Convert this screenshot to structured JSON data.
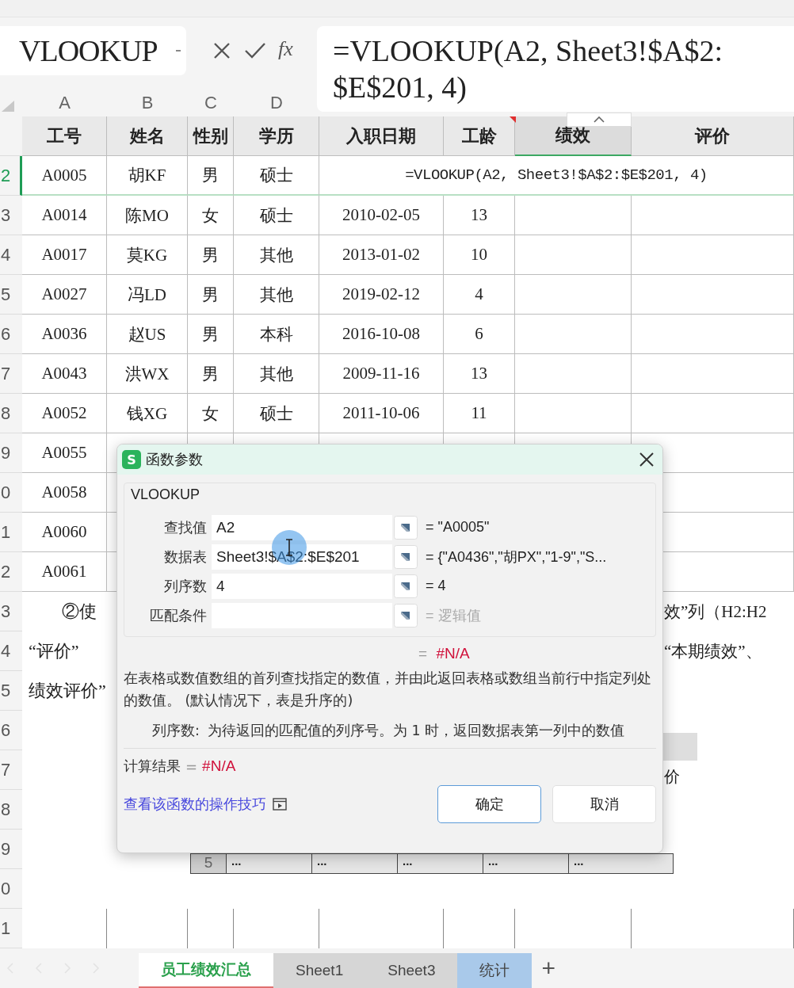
{
  "formula_bar": {
    "name_box": "VLOOKUP",
    "fx_label": "fx",
    "lines": [
      "=VLOOKUP(A2, Sheet3!$A$2:",
      "$E$201, 4)"
    ]
  },
  "column_letters": [
    "A",
    "B",
    "C",
    "D"
  ],
  "headers": [
    {
      "text": "工号",
      "selected": false
    },
    {
      "text": "姓名",
      "selected": false
    },
    {
      "text": "性别",
      "selected": false
    },
    {
      "text": "学历",
      "selected": false
    },
    {
      "text": "入职日期",
      "selected": false
    },
    {
      "text": "工龄",
      "selected": false
    },
    {
      "text": "绩效",
      "selected": true
    },
    {
      "text": "评价",
      "selected": false
    }
  ],
  "rows": [
    {
      "row": "2",
      "selected": true,
      "cells": [
        "A0005",
        "胡KF",
        "男",
        "硕士"
      ],
      "spill": "=VLOOKUP(A2, Sheet3!$A$2:$E$201, 4)"
    },
    {
      "row": "3",
      "selected": false,
      "cells": [
        "A0014",
        "陈MO",
        "女",
        "硕士",
        "2010-02-05",
        "13"
      ]
    },
    {
      "row": "4",
      "selected": false,
      "cells": [
        "A0017",
        "莫KG",
        "男",
        "其他",
        "2013-01-02",
        "10"
      ]
    },
    {
      "row": "5",
      "selected": false,
      "cells": [
        "A0027",
        "冯LD",
        "男",
        "其他",
        "2019-02-12",
        "4"
      ]
    },
    {
      "row": "6",
      "selected": false,
      "cells": [
        "A0036",
        "赵US",
        "男",
        "本科",
        "2016-10-08",
        "6"
      ]
    },
    {
      "row": "7",
      "selected": false,
      "cells": [
        "A0043",
        "洪WX",
        "男",
        "其他",
        "2009-11-16",
        "13"
      ]
    },
    {
      "row": "8",
      "selected": false,
      "cells": [
        "A0052",
        "钱XG",
        "女",
        "硕士",
        "2011-10-06",
        "11"
      ]
    },
    {
      "row": "9",
      "selected": false,
      "cells": [
        "A0055"
      ]
    },
    {
      "row": "0",
      "selected": false,
      "cells": [
        "A0058"
      ]
    },
    {
      "row": "1",
      "selected": false,
      "cells": [
        "A0060"
      ]
    },
    {
      "row": "2",
      "selected": false,
      "cells": [
        "A0061"
      ]
    }
  ],
  "notes": [
    {
      "row": "3",
      "left": "②使",
      "right": "效”列（H2:H2"
    },
    {
      "row": "4",
      "left": "“评价”",
      "right": "“本期绩效”、"
    },
    {
      "row": "5",
      "left": "绩效评价”"
    }
  ],
  "blank_rows": [
    "6",
    "7",
    "8",
    "9",
    "0",
    "1"
  ],
  "embedded_table": {
    "header_text": "价",
    "last_row": {
      "number": "5",
      "cells": [
        "...",
        "...",
        "...",
        "...",
        "..."
      ]
    }
  },
  "dialog": {
    "badge": "S",
    "title": "函数参数",
    "function": "VLOOKUP",
    "params": [
      {
        "label": "查找值",
        "value": "A2",
        "result": "= \"A0005\"",
        "muted": false
      },
      {
        "label": "数据表",
        "value": "Sheet3!$A$2:$E$201",
        "result": "= {\"A0436\",\"胡PX\",\"1-9\",\"S...",
        "muted": false
      },
      {
        "label": "列序数",
        "value": "4",
        "result": "= 4",
        "muted": false
      },
      {
        "label": "匹配条件",
        "result": "= 逻辑值",
        "muted": true
      }
    ],
    "result": {
      "sign": "=",
      "value": "#N/A"
    },
    "description": "在表格或数值数组的首列查找指定的数值，并由此返回表格或数组当前行中指定列处的数值。 (默认情况下，表是升序的)",
    "param_help": {
      "label": "列序数:",
      "text": "为待返回的匹配值的列序号。为 1 时，返回数据表第一列中的数值"
    },
    "calc": {
      "label": "计算结果",
      "sign": "=",
      "value": "#N/A"
    },
    "link": "查看该函数的操作技巧",
    "buttons": [
      {
        "label": "确定",
        "primary": true
      },
      {
        "label": "取消",
        "primary": false
      }
    ]
  },
  "sheet_tabs": [
    {
      "label": "员工绩效汇总",
      "selected": true
    },
    {
      "label": "Sheet1",
      "selected": false,
      "color": "#d6d6d6"
    },
    {
      "label": "Sheet3",
      "selected": false,
      "color": "#d6d6d6"
    },
    {
      "label": "统计",
      "selected": false,
      "color": "#a9c9ea"
    }
  ],
  "add_sheet": "+"
}
